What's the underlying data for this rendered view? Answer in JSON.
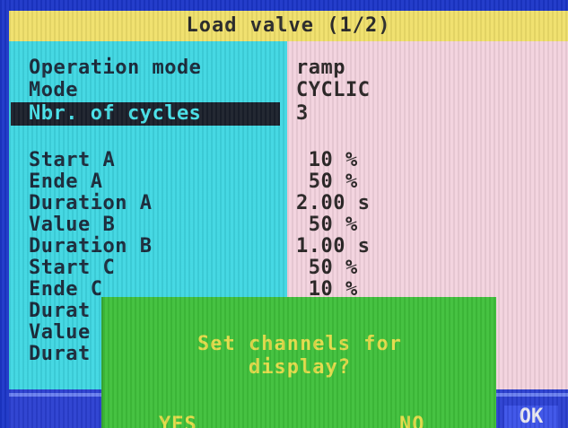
{
  "window": {
    "title": "Load valve (1/2)"
  },
  "params": [
    {
      "label": "Operation mode",
      "value": "ramp"
    },
    {
      "label": "Mode",
      "value": "CYCLIC"
    },
    {
      "label": "Nbr. of cycles",
      "value": "3"
    },
    {
      "label": "Start A",
      "value": " 10 %"
    },
    {
      "label": "Ende A",
      "value": " 50 %"
    },
    {
      "label": "Duration A",
      "value": "2.00 s"
    },
    {
      "label": "Value B",
      "value": " 50 %"
    },
    {
      "label": "Duration B",
      "value": "1.00 s"
    },
    {
      "label": "Start C",
      "value": " 50 %"
    },
    {
      "label": "Ende C",
      "value": " 10 %"
    },
    {
      "label": "Durat",
      "value": ""
    },
    {
      "label": "Value",
      "value": ""
    },
    {
      "label": "Durat",
      "value": ""
    }
  ],
  "dialog": {
    "message_line1": "Set channels for",
    "message_line2": "display?",
    "yes_label": "YES",
    "no_label": "NO"
  },
  "footer": {
    "ok_label": "OK"
  },
  "colors": {
    "title_bg": "#f0e06a",
    "left_pane": "#3fd7e2",
    "right_pane": "#f3d2de",
    "dialog_bg": "#3fc03a",
    "dialog_text": "#e2dc4a",
    "footer_bg": "#2a3fd0"
  }
}
